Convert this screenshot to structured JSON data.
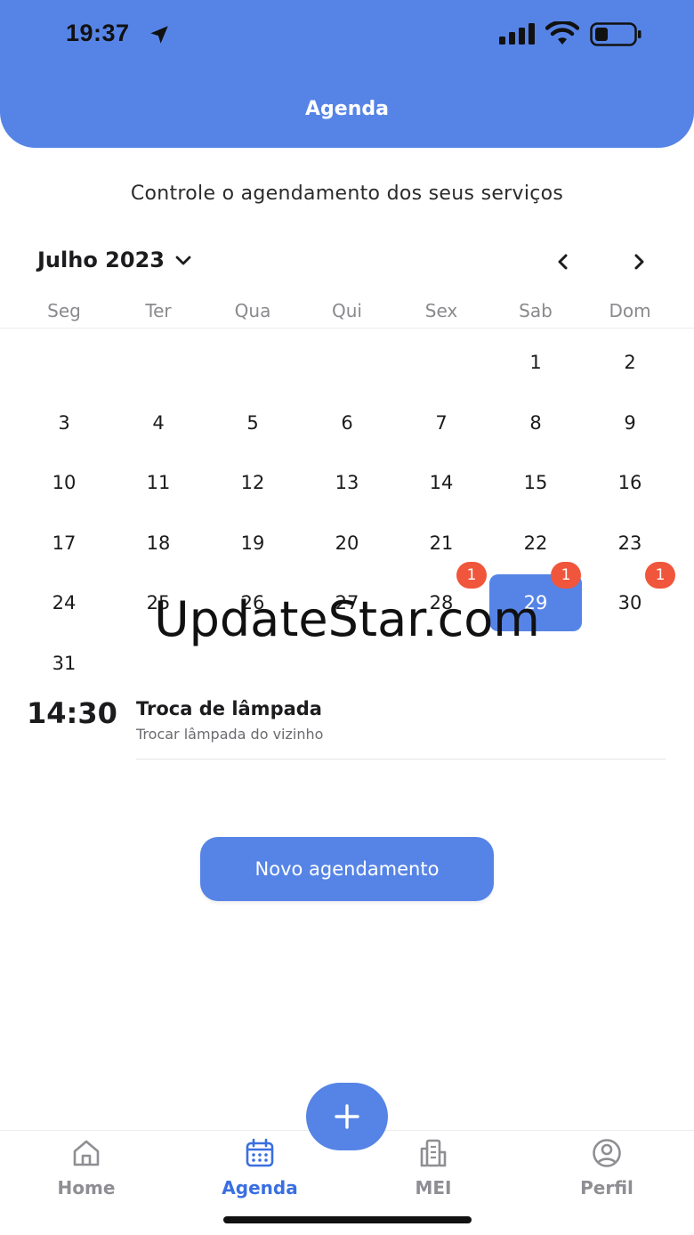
{
  "status_bar": {
    "time": "19:37"
  },
  "header": {
    "title": "Agenda"
  },
  "subtitle": "Controle o agendamento dos seus serviços",
  "calendar": {
    "month_label": "Julho 2023",
    "weekdays": [
      "Seg",
      "Ter",
      "Qua",
      "Qui",
      "Sex",
      "Sab",
      "Dom"
    ],
    "days": [
      "1",
      "2",
      "3",
      "4",
      "5",
      "6",
      "7",
      "8",
      "9",
      "10",
      "11",
      "12",
      "13",
      "14",
      "15",
      "16",
      "17",
      "18",
      "19",
      "20",
      "21",
      "22",
      "23",
      "24",
      "25",
      "26",
      "27",
      "28",
      "29",
      "30",
      "31"
    ],
    "first_weekday_index": 5,
    "selected_day": "29",
    "badges": {
      "28": "1",
      "29": "1",
      "30": "1"
    }
  },
  "event": {
    "time": "14:30",
    "title": "Troca de lâmpada",
    "description": "Trocar lâmpada do vizinho"
  },
  "new_button_label": "Novo agendamento",
  "watermark": "UpdateStar.com",
  "tabbar": {
    "home_label": "Home",
    "agenda_label": "Agenda",
    "mei_label": "MEI",
    "perfil_label": "Perfil",
    "active": "agenda"
  },
  "colors": {
    "primary": "#5684e6",
    "badge": "#f0563b",
    "active_tab": "#3a6fe0"
  }
}
